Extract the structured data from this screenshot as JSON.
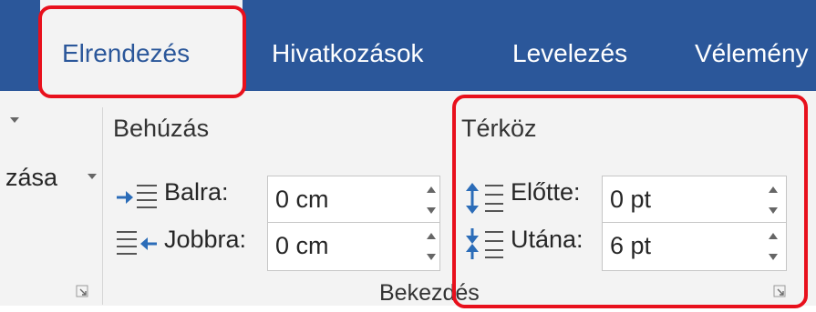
{
  "tabs": [
    {
      "label": "Elrendezés",
      "active": true
    },
    {
      "label": "Hivatkozások",
      "active": false
    },
    {
      "label": "Levelezés",
      "active": false
    },
    {
      "label": "Vélemény",
      "active": false
    }
  ],
  "left_partial": {
    "label": "zása",
    "has_dropdown": true
  },
  "indent": {
    "title": "Behúzás",
    "left_label": "Balra:",
    "left_value": "0 cm",
    "right_label": "Jobbra:",
    "right_value": "0 cm"
  },
  "spacing": {
    "title": "Térköz",
    "before_label": "Előtte:",
    "before_value": "0 pt",
    "after_label": "Utána:",
    "after_value": "6 pt"
  },
  "group_label": "Bekezdés",
  "icons": {
    "indent_left": "indent-left-icon",
    "indent_right": "indent-right-icon",
    "spacing_before": "spacing-before-icon",
    "spacing_after": "spacing-after-icon",
    "dialog_launcher": "dialog-launcher-icon",
    "dropdown": "dropdown-arrow-icon",
    "spin_up": "spin-up-icon",
    "spin_down": "spin-down-icon"
  },
  "colors": {
    "ribbon_blue": "#2b579a",
    "ribbon_bg": "#f3f3f3",
    "icon_blue": "#2b6cb8",
    "highlight_red": "#e8101c"
  }
}
